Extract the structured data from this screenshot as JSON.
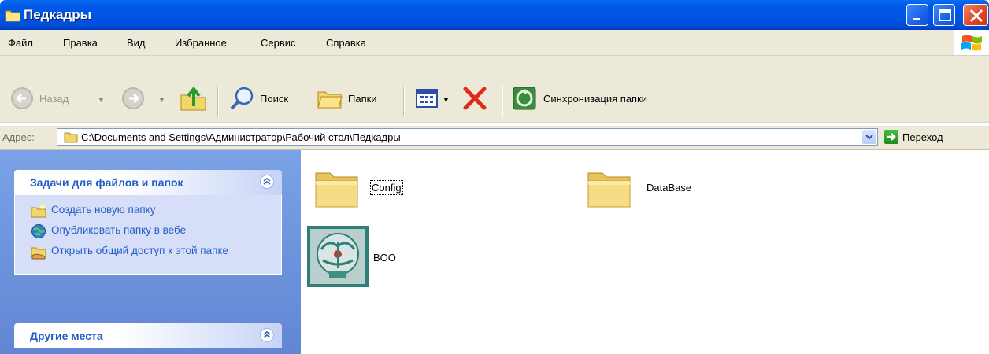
{
  "window": {
    "title": "Педкадры"
  },
  "menu": [
    "Файл",
    "Правка",
    "Вид",
    "Избранное",
    "Сервис",
    "Справка"
  ],
  "toolbar": {
    "back_label": "Назад",
    "search_label": "Поиск",
    "folders_label": "Папки",
    "sync_label": "Синхронизация папки"
  },
  "address": {
    "label": "Адрес:",
    "path": "C:\\Documents and Settings\\Администратор\\Рабочий стол\\Педкадры",
    "go_label": "Переход"
  },
  "taskpane": {
    "file_tasks": {
      "title": "Задачи для файлов и папок",
      "items": [
        {
          "label": "Создать новую папку",
          "icon": "new-folder-icon"
        },
        {
          "label": "Опубликовать папку в вебе",
          "icon": "publish-web-icon"
        },
        {
          "label": "Открыть общий доступ к этой папке",
          "icon": "share-folder-icon"
        }
      ]
    },
    "other_places": {
      "title": "Другие места"
    }
  },
  "files": [
    {
      "name": "Config",
      "icon": "folder-icon",
      "selected": true
    },
    {
      "name": "DataBase",
      "icon": "folder-icon",
      "selected": false
    },
    {
      "name": "BOO",
      "icon": "app-emblem-icon",
      "selected": false
    }
  ],
  "colors": {
    "title_bar": "#0055e5",
    "chrome": "#ece9d8",
    "task_pane": "#6e93dc",
    "link": "#215dc6"
  }
}
